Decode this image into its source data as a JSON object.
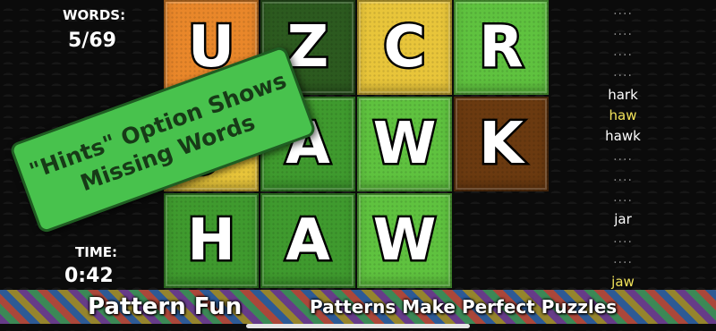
{
  "stats": {
    "words_label": "WORDS:",
    "words_value": "5/69",
    "time_label": "TIME:",
    "time_value": "0:42"
  },
  "board": {
    "tiles": [
      {
        "letter": "U",
        "color": "#e9872a"
      },
      {
        "letter": "Z",
        "color": "#2c5a1f"
      },
      {
        "letter": "C",
        "color": "#e8c53a"
      },
      {
        "letter": "R",
        "color": "#5fc23f"
      },
      {
        "letter": "J",
        "color": "#e8c53a"
      },
      {
        "letter": "A",
        "color": "#3f9a2e"
      },
      {
        "letter": "W",
        "color": "#5fc23f"
      },
      {
        "letter": "K",
        "color": "#6b3a10"
      },
      {
        "letter": "H",
        "color": "#3f9a2e"
      },
      {
        "letter": "A",
        "color": "#3f9a2e"
      },
      {
        "letter": "W",
        "color": "#5fc23f"
      }
    ]
  },
  "word_list": {
    "items": [
      {
        "text": "....",
        "kind": "dots"
      },
      {
        "text": "....",
        "kind": "dots"
      },
      {
        "text": "....",
        "kind": "dots"
      },
      {
        "text": "....",
        "kind": "dots"
      },
      {
        "text": "hark",
        "kind": "word"
      },
      {
        "text": "haw",
        "kind": "highlight"
      },
      {
        "text": "hawk",
        "kind": "word"
      },
      {
        "text": "....",
        "kind": "dots"
      },
      {
        "text": "....",
        "kind": "dots"
      },
      {
        "text": "....",
        "kind": "dots"
      },
      {
        "text": "jar",
        "kind": "word"
      },
      {
        "text": "....",
        "kind": "dots"
      },
      {
        "text": "....",
        "kind": "dots"
      },
      {
        "text": "jaw",
        "kind": "highlight"
      }
    ]
  },
  "banner": {
    "title": "Pattern Fun",
    "tagline": "Patterns Make Perfect Puzzles"
  },
  "callout": {
    "line1": "\"Hints\" Option Shows",
    "line2": "Missing Words"
  },
  "colors": {
    "highlight_word": "#f2e35a",
    "callout_bg": "#48c24d"
  }
}
